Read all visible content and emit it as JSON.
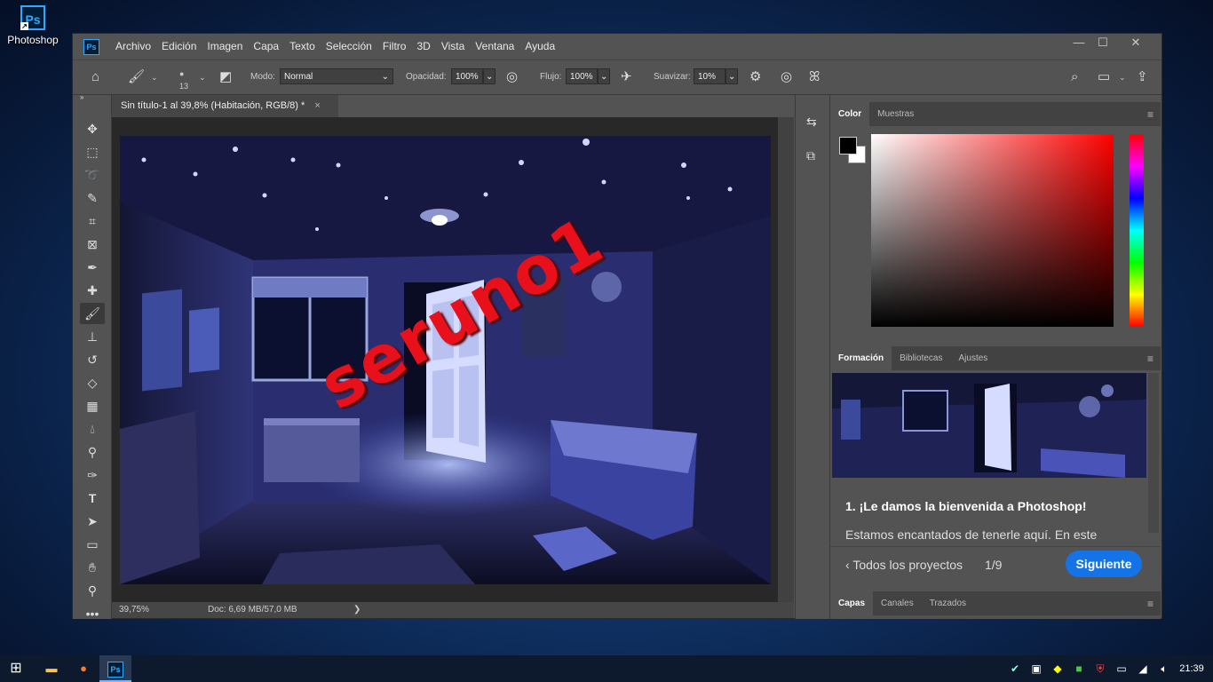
{
  "desktop": {
    "icon_label": "Photoshop",
    "icon_text": "Ps"
  },
  "window": {
    "app_icon": "Ps",
    "menus": [
      "Archivo",
      "Edición",
      "Imagen",
      "Capa",
      "Texto",
      "Selección",
      "Filtro",
      "3D",
      "Vista",
      "Ventana",
      "Ayuda"
    ],
    "controls": {
      "minimize": "—",
      "maximize": "☐",
      "close": "✕"
    }
  },
  "options": {
    "brush_size": "13",
    "mode_label": "Modo:",
    "mode_value": "Normal",
    "opacity_label": "Opacidad:",
    "opacity_value": "100%",
    "flow_label": "Flujo:",
    "flow_value": "100%",
    "smooth_label": "Suavizar:",
    "smooth_value": "10%"
  },
  "document": {
    "tab_title": "Sin título-1 al 39,8% (Habitación, RGB/8) *",
    "tab_close": "×",
    "watermark": "seruno1",
    "zoom": "39,75%",
    "doc_info": "Doc: 6,69 MB/57,0 MB",
    "status_arrow": "❯"
  },
  "panels": {
    "color_tabs": [
      "Color",
      "Muestras"
    ],
    "learn_tabs": [
      "Formación",
      "Bibliotecas",
      "Ajustes"
    ],
    "learn_title": "1.  ¡Le damos la bienvenida a Photoshop!",
    "learn_text": "Estamos encantados de tenerle aquí. En este",
    "back_link": "Todos los proyectos",
    "progress": "1/9",
    "next_button": "Siguiente",
    "layer_tabs": [
      "Capas",
      "Canales",
      "Trazados"
    ]
  },
  "taskbar": {
    "clock": "21:39",
    "apps": [
      "windows-start",
      "file-explorer",
      "firefox",
      "photoshop"
    ]
  },
  "colors": {
    "accent": "#1473e6",
    "watermark": "#e8101a",
    "ps_blue": "#31a8ff",
    "panel_bg": "#535353"
  }
}
